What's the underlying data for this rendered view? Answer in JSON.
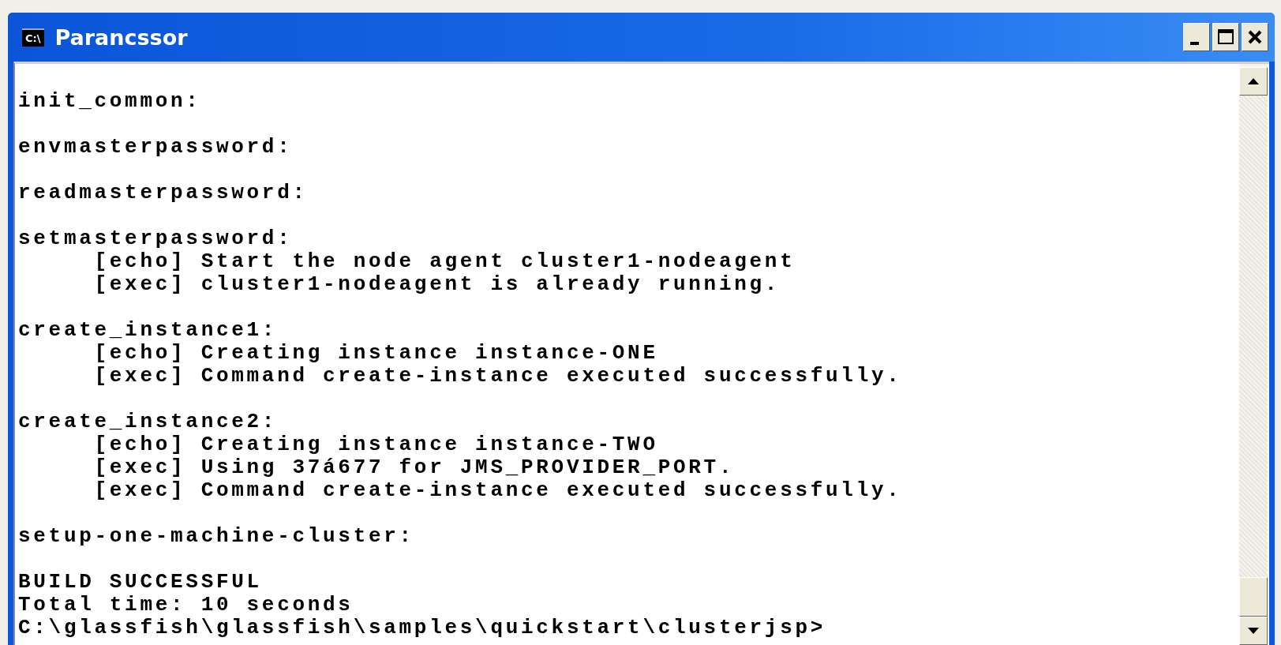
{
  "window": {
    "title": "Parancssor",
    "icon_text": "C:\\"
  },
  "console": {
    "blocks": [
      {
        "lines": [
          "init_common:"
        ]
      },
      {
        "lines": [
          "envmasterpassword:"
        ]
      },
      {
        "lines": [
          "readmasterpassword:"
        ]
      },
      {
        "lines": [
          "setmasterpassword:",
          "     [echo] Start the node agent cluster1-nodeagent",
          "     [exec] cluster1-nodeagent is already running."
        ]
      },
      {
        "lines": [
          "create_instance1:",
          "     [echo] Creating instance instance-ONE",
          "     [exec] Command create-instance executed successfully."
        ]
      },
      {
        "lines": [
          "create_instance2:",
          "     [echo] Creating instance instance-TWO",
          "     [exec] Using 37á677 for JMS_PROVIDER_PORT.",
          "     [exec] Command create-instance executed successfully."
        ]
      },
      {
        "lines": [
          "setup-one-machine-cluster:"
        ]
      },
      {
        "lines": [
          "BUILD SUCCESSFUL",
          "Total time: 10 seconds",
          "C:\\glassfish\\glassfish\\samples\\quickstart\\clusterjsp>"
        ]
      }
    ]
  }
}
